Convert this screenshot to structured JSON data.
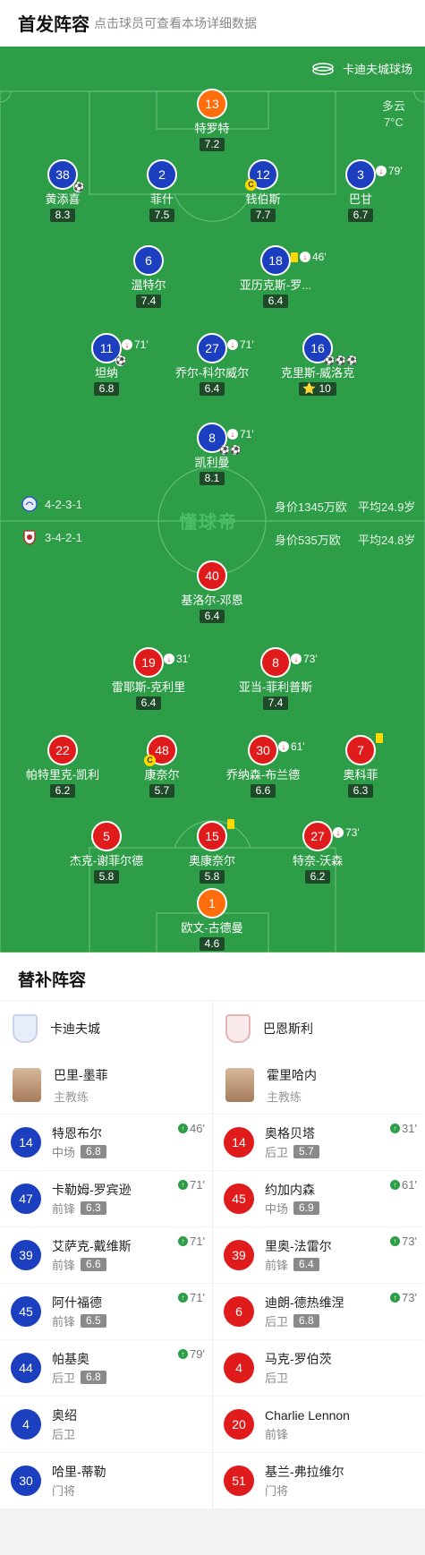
{
  "header": {
    "title": "首发阵容",
    "subtitle": "点击球员可查看本场详细数据"
  },
  "pitch": {
    "stadium": "卡迪夫城球场",
    "weather": {
      "desc": "多云",
      "temp": "7°C"
    },
    "watermark": "懂球帝",
    "home": {
      "formation": "4-2-3-1",
      "value": "身价1345万欧",
      "age": "平均24.9岁"
    },
    "away": {
      "formation": "3-4-2-1",
      "value": "身价535万欧",
      "age": "平均24.8岁"
    }
  },
  "home_players": [
    {
      "num": "13",
      "name": "特罗特",
      "rating": "7.2",
      "gk": true
    },
    {
      "num": "38",
      "name": "黄添喜",
      "rating": "8.3",
      "ball": true
    },
    {
      "num": "2",
      "name": "菲什",
      "rating": "7.5"
    },
    {
      "num": "12",
      "name": "钱伯斯",
      "rating": "7.7",
      "captain": true
    },
    {
      "num": "3",
      "name": "巴甘",
      "rating": "6.7",
      "sub_out": "79'"
    },
    {
      "num": "6",
      "name": "温特尔",
      "rating": "7.4"
    },
    {
      "num": "18",
      "name": "亚历克斯-罗...",
      "rating": "6.4",
      "sub_out": "46'",
      "yellow": true
    },
    {
      "num": "11",
      "name": "坦纳",
      "rating": "6.8",
      "sub_out": "71'",
      "ball": true
    },
    {
      "num": "27",
      "name": "乔尔-科尔威尔",
      "rating": "6.4",
      "sub_out": "71'"
    },
    {
      "num": "16",
      "name": "克里斯-威洛克",
      "rating": "10",
      "star": true,
      "ball": true
    },
    {
      "num": "8",
      "name": "凯利曼",
      "rating": "8.1",
      "sub_out": "71'",
      "ball": true
    }
  ],
  "away_players": [
    {
      "num": "40",
      "name": "基洛尔-邓恩",
      "rating": "6.4"
    },
    {
      "num": "19",
      "name": "雷耶斯-克利里",
      "rating": "6.4",
      "sub_out": "31'"
    },
    {
      "num": "8",
      "name": "亚当-菲利普斯",
      "rating": "7.4",
      "sub_out": "73'"
    },
    {
      "num": "22",
      "name": "帕特里克-凯利",
      "rating": "6.2"
    },
    {
      "num": "48",
      "name": "康奈尔",
      "rating": "5.7",
      "captain": true
    },
    {
      "num": "30",
      "name": "乔纳森-布兰德",
      "rating": "6.6",
      "sub_out": "61'"
    },
    {
      "num": "7",
      "name": "奥科菲",
      "rating": "6.3",
      "yellow": true
    },
    {
      "num": "5",
      "name": "杰克-谢菲尔德",
      "rating": "5.8"
    },
    {
      "num": "15",
      "name": "奥康奈尔",
      "rating": "5.8",
      "yellow": true
    },
    {
      "num": "27",
      "name": "特奈-沃森",
      "rating": "6.2",
      "sub_out": "73'"
    },
    {
      "num": "1",
      "name": "欧文-古德曼",
      "rating": "4.6",
      "gk": true
    }
  ],
  "subs": {
    "title": "替补阵容",
    "home": {
      "team": "卡迪夫城",
      "coach": {
        "name": "巴里-墨菲",
        "role": "主教练"
      },
      "players": [
        {
          "num": "14",
          "name": "特恩布尔",
          "pos": "中场",
          "rating": "6.8",
          "in": "46'"
        },
        {
          "num": "47",
          "name": "卡勒姆-罗宾逊",
          "pos": "前锋",
          "rating": "6.3",
          "in": "71'"
        },
        {
          "num": "39",
          "name": "艾萨克-戴维斯",
          "pos": "前锋",
          "rating": "6.6",
          "in": "71'"
        },
        {
          "num": "45",
          "name": "阿什福德",
          "pos": "前锋",
          "rating": "6.5",
          "in": "71'"
        },
        {
          "num": "44",
          "name": "帕基奥",
          "pos": "后卫",
          "rating": "6.8",
          "in": "79'"
        },
        {
          "num": "4",
          "name": "奥绍",
          "pos": "后卫"
        },
        {
          "num": "30",
          "name": "哈里-蒂勒",
          "pos": "门将"
        }
      ]
    },
    "away": {
      "team": "巴恩斯利",
      "coach": {
        "name": "霍里哈内",
        "role": "主教练"
      },
      "players": [
        {
          "num": "14",
          "name": "奥格贝塔",
          "pos": "后卫",
          "rating": "5.7",
          "in": "31'"
        },
        {
          "num": "45",
          "name": "约加内森",
          "pos": "中场",
          "rating": "6.9",
          "in": "61'"
        },
        {
          "num": "39",
          "name": "里奥-法雷尔",
          "pos": "前锋",
          "rating": "6.4",
          "in": "73'"
        },
        {
          "num": "6",
          "name": "迪朗-德热维涅",
          "pos": "后卫",
          "rating": "6.8",
          "in": "73'"
        },
        {
          "num": "4",
          "name": "马克-罗伯茨",
          "pos": "后卫"
        },
        {
          "num": "20",
          "name": "Charlie Lennon",
          "pos": "前锋"
        },
        {
          "num": "51",
          "name": "基兰-弗拉维尔",
          "pos": "门将"
        }
      ]
    }
  }
}
